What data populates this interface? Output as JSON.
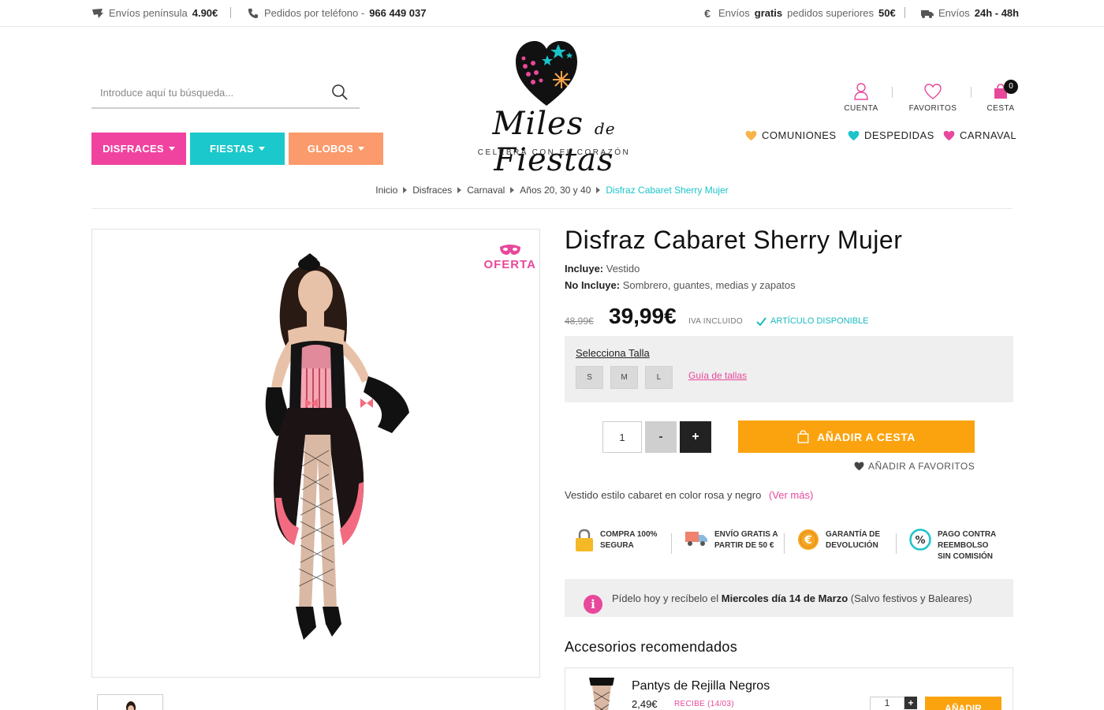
{
  "topbar": {
    "shipping_label": "Envíos península",
    "shipping_price": "4.90€",
    "phone_label": "Pedidos por teléfono -",
    "phone_number": "966 449 037",
    "free_pre": "Envíos",
    "free_bold": "gratis",
    "free_mid": "pedidos superiores",
    "free_amount": "50€",
    "delivery_pre": "Envíos",
    "delivery_time": "24h - 48h"
  },
  "search": {
    "placeholder": "Introduce aquí tu búsqueda..."
  },
  "categories": [
    {
      "label": "DISFRACES",
      "color": "#f043a0"
    },
    {
      "label": "FIESTAS",
      "color": "#1bc8cb"
    },
    {
      "label": "GLOBOS",
      "color": "#fb9a6c"
    }
  ],
  "logo": {
    "word_1": "Miles",
    "word_de": "de",
    "word_2": "Fiestas",
    "tagline": "CELEBRA CON EL CORAZÓN"
  },
  "account": {
    "cuenta": "CUENTA",
    "favoritos": "FAVORITOS",
    "cesta": "CESTA",
    "cart_count": "0"
  },
  "themes": [
    {
      "label": "COMUNIONES",
      "color": "#f7b44a"
    },
    {
      "label": "DESPEDIDAS",
      "color": "#1bc4c9"
    },
    {
      "label": "CARNAVAL",
      "color": "#e8489b"
    }
  ],
  "breadcrumb": [
    "Inicio",
    "Disfraces",
    "Carnaval",
    "Años 20, 30 y 40",
    "Disfraz Cabaret Sherry Mujer"
  ],
  "product": {
    "oferta": "OFERTA",
    "title": "Disfraz Cabaret Sherry Mujer",
    "includes_label": "Incluye:",
    "includes_value": "Vestido",
    "excludes_label": "No Incluye:",
    "excludes_value": "Sombrero, guantes, medias y zapatos",
    "old_price": "48,99€",
    "price": "39,99€",
    "iva": "IVA INCLUIDO",
    "availability": "ARTÍCULO DISPONIBLE",
    "size_label": "Selecciona Talla",
    "sizes": [
      "S",
      "M",
      "L"
    ],
    "size_guide": "Guía de tallas",
    "quantity": "1",
    "minus": "-",
    "plus": "+",
    "add_to_cart": "AÑADIR A CESTA",
    "add_to_fav": "AÑADIR A FAVORITOS",
    "description": "Vestido estilo cabaret en color rosa y negro",
    "see_more": "(Ver más)"
  },
  "features": [
    {
      "line1": "COMPRA 100%",
      "line2": "SEGURA",
      "line3": "",
      "icon": "lock-icon"
    },
    {
      "line1": "ENVÍO GRATIS A",
      "line2": "PARTIR DE 50 €",
      "line3": "",
      "icon": "truck-icon"
    },
    {
      "line1": "GARANTÍA DE",
      "line2": "DEVOLUCIÓN",
      "line3": "",
      "icon": "euro-icon"
    },
    {
      "line1": "PAGO CONTRA",
      "line2": "REEMBOLSO",
      "line3": "SIN COMISIÓN",
      "icon": "percent-icon"
    }
  ],
  "delivery": {
    "pre": "Pídelo hoy y recíbelo el",
    "date": "Miercoles día 14 de Marzo",
    "post": "(Salvo festivos y Baleares)"
  },
  "accessories": {
    "heading": "Accesorios recomendados",
    "items": [
      {
        "name": "Pantys de Rejilla Negros",
        "price": "2,49€",
        "recibe": "RECIBE (14/03)",
        "quantity": "1",
        "add": "AÑADIR"
      }
    ]
  }
}
